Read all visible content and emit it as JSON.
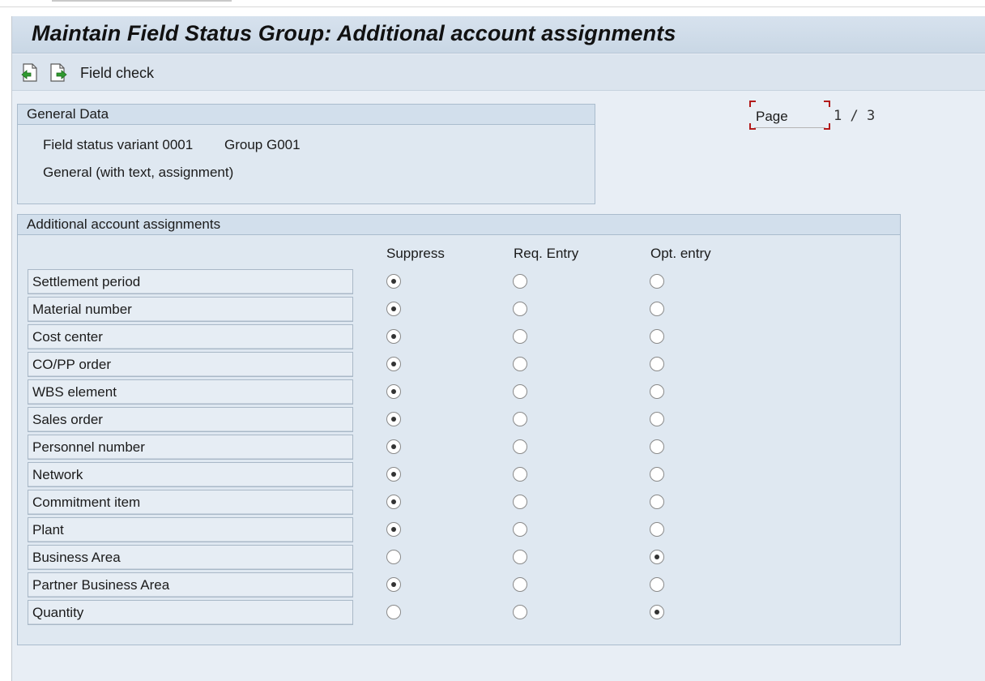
{
  "window": {
    "title": "Maintain Field Status Group: Additional account assignments"
  },
  "toolbar": {
    "buttons": [
      {
        "name": "previous-page",
        "icon": "page-back-green-arrow-icon"
      },
      {
        "name": "next-page",
        "icon": "page-forward-green-arrow-icon"
      }
    ],
    "field_check_label": "Field check"
  },
  "general_data": {
    "header": "General Data",
    "variant_text": "Field status variant 0001",
    "group_text": "Group G001",
    "description": "General (with text, assignment)"
  },
  "pager": {
    "label": "Page",
    "current": "1",
    "separator": "/",
    "total": "3"
  },
  "assignments": {
    "header": "Additional account assignments",
    "columns": [
      "Suppress",
      "Req. Entry",
      "Opt. entry"
    ],
    "rows": [
      {
        "label": "Settlement period",
        "selected": "Suppress"
      },
      {
        "label": "Material number",
        "selected": "Suppress"
      },
      {
        "label": "Cost center",
        "selected": "Suppress"
      },
      {
        "label": "CO/PP order",
        "selected": "Suppress"
      },
      {
        "label": "WBS element",
        "selected": "Suppress"
      },
      {
        "label": "Sales order",
        "selected": "Suppress"
      },
      {
        "label": "Personnel number",
        "selected": "Suppress"
      },
      {
        "label": "Network",
        "selected": "Suppress"
      },
      {
        "label": "Commitment item",
        "selected": "Suppress"
      },
      {
        "label": "Plant",
        "selected": "Suppress"
      },
      {
        "label": "Business Area",
        "selected": "Opt. entry"
      },
      {
        "label": "Partner Business Area",
        "selected": "Suppress"
      },
      {
        "label": "Quantity",
        "selected": "Opt. entry"
      }
    ]
  },
  "colors": {
    "background": "#e8eef5",
    "title_bar": "#c9d7e5",
    "group_header": "#d2dfec",
    "focus_bracket": "#b31b1b"
  }
}
